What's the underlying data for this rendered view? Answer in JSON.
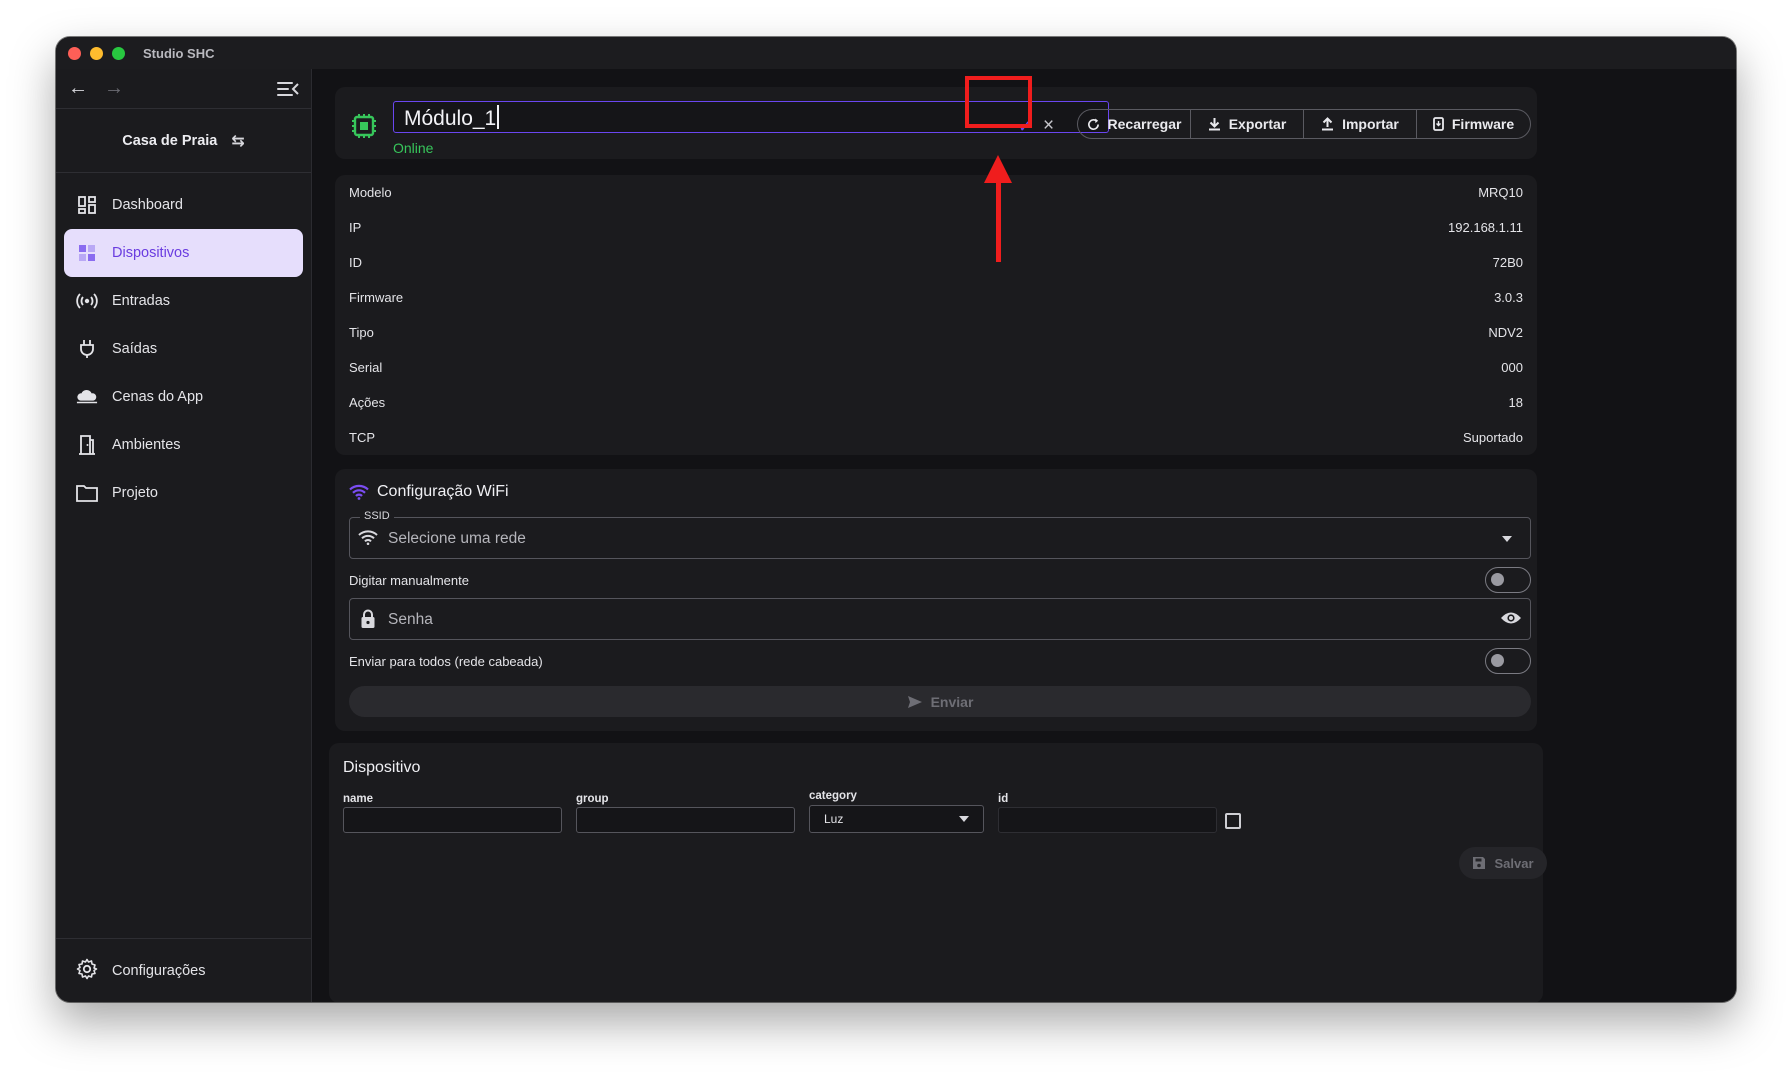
{
  "window": {
    "title": "Studio SHC"
  },
  "sidebar": {
    "project_name": "Casa de Praia",
    "items": [
      {
        "label": "Dashboard",
        "icon": "dashboard-icon",
        "active": false
      },
      {
        "label": "Dispositivos",
        "icon": "devices-icon",
        "active": true
      },
      {
        "label": "Entradas",
        "icon": "broadcast-icon",
        "active": false
      },
      {
        "label": "Saídas",
        "icon": "plug-icon",
        "active": false
      },
      {
        "label": "Cenas do App",
        "icon": "cloud-icon",
        "active": false
      },
      {
        "label": "Ambientes",
        "icon": "door-icon",
        "active": false
      },
      {
        "label": "Projeto",
        "icon": "folder-icon",
        "active": false
      }
    ],
    "footer_label": "Configurações"
  },
  "header": {
    "device_name": "Módulo_1",
    "status": "Online",
    "status_color": "#37c65b",
    "actions": [
      "Recarregar",
      "Exportar",
      "Importar",
      "Firmware"
    ]
  },
  "info": {
    "rows": [
      {
        "label": "Modelo",
        "value": "MRQ10"
      },
      {
        "label": "IP",
        "value": "192.168.1.11"
      },
      {
        "label": "ID",
        "value": "72B0"
      },
      {
        "label": "Firmware",
        "value": "3.0.3"
      },
      {
        "label": "Tipo",
        "value": "NDV2"
      },
      {
        "label": "Serial",
        "value": "000"
      },
      {
        "label": "Ações",
        "value": "18"
      },
      {
        "label": "TCP",
        "value": "Suportado"
      }
    ]
  },
  "wifi": {
    "title": "Configuração WiFi",
    "ssid_label": "SSID",
    "ssid_placeholder": "Selecione uma rede",
    "manual_label": "Digitar manualmente",
    "manual_on": false,
    "password_placeholder": "Senha",
    "send_all_label": "Enviar para todos (rede cabeada)",
    "send_all_on": false,
    "send_label": "Enviar"
  },
  "device_form": {
    "title": "Dispositivo",
    "name_label": "name",
    "group_label": "group",
    "category_label": "category",
    "category_value": "Luz",
    "id_label": "id",
    "save_label": "Salvar"
  },
  "colors": {
    "accent": "#6a46f0",
    "highlight": "#f01d1d"
  }
}
